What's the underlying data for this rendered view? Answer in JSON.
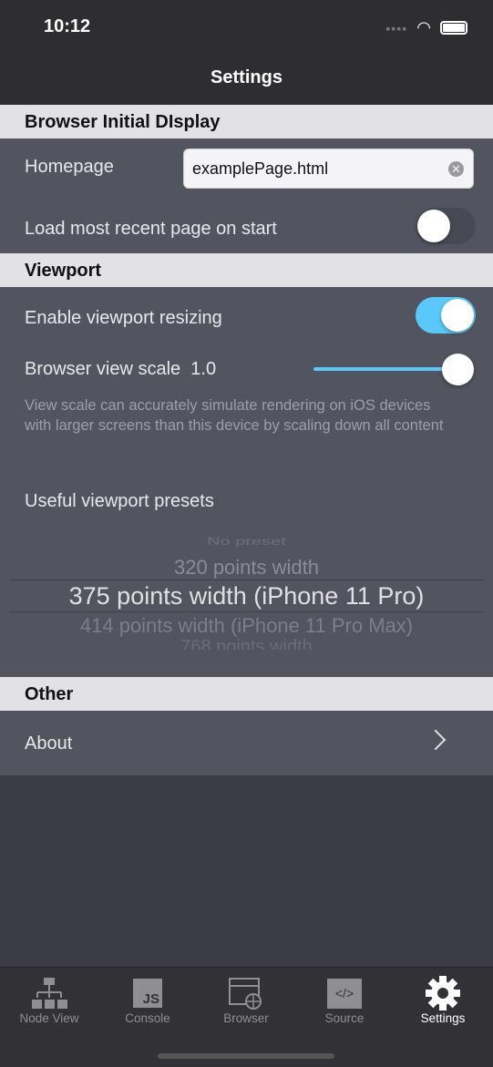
{
  "status": {
    "time": "10:12"
  },
  "nav": {
    "title": "Settings"
  },
  "sections": {
    "browser": {
      "header": "Browser Initial DIsplay",
      "homepage_label": "Homepage",
      "homepage_value": "examplePage.html",
      "load_recent_label": "Load most recent page on start",
      "load_recent_on": false
    },
    "viewport": {
      "header": "Viewport",
      "resize_label": "Enable viewport resizing",
      "resize_on": true,
      "scale_label": "Browser view scale",
      "scale_value": "1.0",
      "scale_fraction": 1.0,
      "note": "View scale can accurately simulate rendering on iOS devices with larger screens than this device by scaling down all content",
      "presets_label": "Useful viewport presets",
      "presets": [
        "No preset",
        "320 points width",
        "375 points width (iPhone 11 Pro)",
        "414 points width (iPhone 11 Pro Max)",
        "768 points width"
      ],
      "selected_preset": "375 points width (iPhone 11 Pro)"
    },
    "other": {
      "header": "Other",
      "about_label": "About"
    }
  },
  "tabs": [
    {
      "label": "Node View",
      "icon": "hierarchy-icon"
    },
    {
      "label": "Console",
      "icon": "js-icon"
    },
    {
      "label": "Browser",
      "icon": "browser-globe-icon"
    },
    {
      "label": "Source",
      "icon": "code-icon"
    },
    {
      "label": "Settings",
      "icon": "gear-icon",
      "active": true
    }
  ],
  "colors": {
    "accent": "#5ac8fa",
    "section_bg": "#e2e2e4",
    "row_bg": "#525460"
  }
}
